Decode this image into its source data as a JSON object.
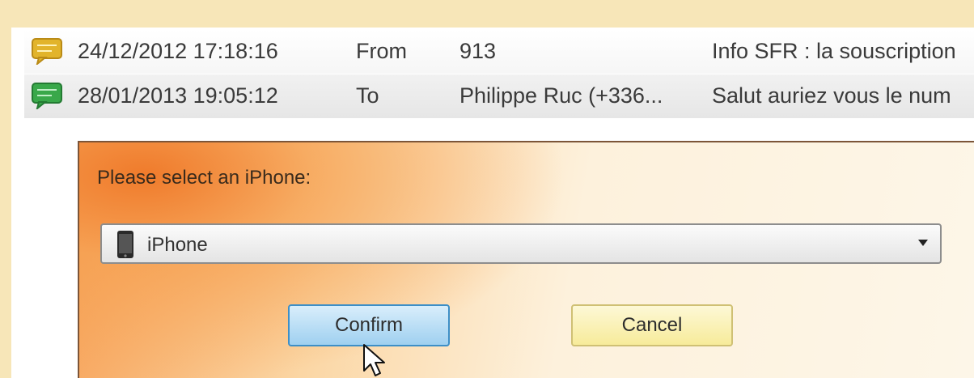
{
  "messages": [
    {
      "icon": "speech-bubble-yellow-icon",
      "date": "24/12/2012 17:18:16",
      "direction": "From",
      "contact": "913",
      "text": "Info SFR : la souscription"
    },
    {
      "icon": "speech-bubble-green-icon",
      "date": "28/01/2013 19:05:12",
      "direction": "To",
      "contact": "Philippe Ruc (+336...",
      "text": "Salut auriez vous le num"
    }
  ],
  "dialog": {
    "prompt": "Please select an iPhone:",
    "selected_device": "iPhone",
    "confirm_label": "Confirm",
    "cancel_label": "Cancel"
  },
  "colors": {
    "yellow_bubble": "#e2b42b",
    "green_bubble": "#39a84a",
    "confirm_border": "#3d8fc7",
    "dialog_accent": "#ef7828"
  }
}
